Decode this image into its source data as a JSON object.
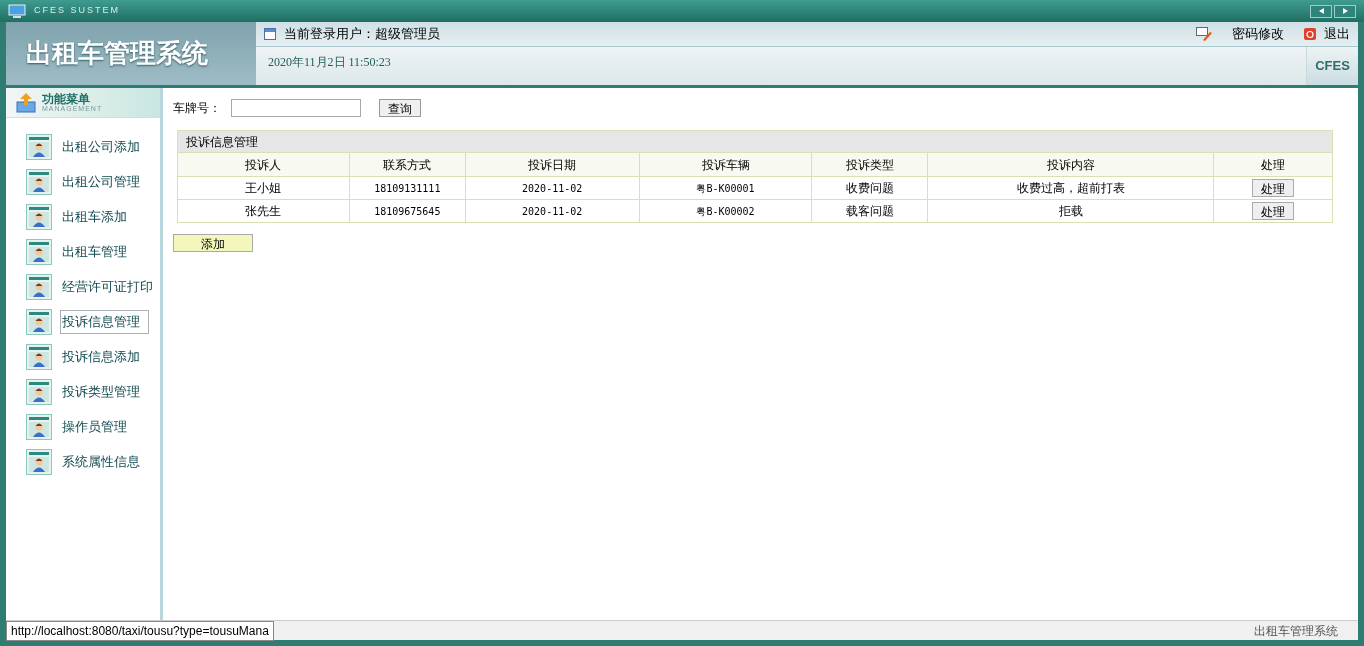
{
  "window": {
    "title": "CFES SUSTEM"
  },
  "header": {
    "app_title": "出租车管理系统",
    "user_label": "当前登录用户：超级管理员",
    "datetime": "2020年11月2日 11:50:23",
    "links": [
      "密码修改",
      "退出"
    ],
    "badge": "CFES"
  },
  "sidebar": {
    "title": "功能菜单",
    "subtitle": "MANAGEMENT",
    "items": [
      {
        "label": "出租公司添加",
        "selected": false
      },
      {
        "label": "出租公司管理",
        "selected": false
      },
      {
        "label": "出租车添加",
        "selected": false
      },
      {
        "label": "出租车管理",
        "selected": false
      },
      {
        "label": "经营许可证打印",
        "selected": false
      },
      {
        "label": "投诉信息管理",
        "selected": true
      },
      {
        "label": "投诉信息添加",
        "selected": false
      },
      {
        "label": "投诉类型管理",
        "selected": false
      },
      {
        "label": "操作员管理",
        "selected": false
      },
      {
        "label": "系统属性信息",
        "selected": false
      }
    ]
  },
  "search": {
    "label": "车牌号：",
    "button": "查询"
  },
  "table": {
    "title": "投诉信息管理",
    "columns": [
      "投诉人",
      "联系方式",
      "投诉日期",
      "投诉车辆",
      "投诉类型",
      "投诉内容",
      "处理"
    ],
    "rows": [
      {
        "cells": [
          "王小姐",
          "18109131111",
          "2020-11-02",
          "粤B-K00001",
          "收费问题",
          "收费过高，超前打表"
        ],
        "action": "处理"
      },
      {
        "cells": [
          "张先生",
          "18109675645",
          "2020-11-02",
          "粤B-K00002",
          "载客问题",
          "拒载"
        ],
        "action": "处理"
      }
    ]
  },
  "add_button": "添加",
  "status_bar": {
    "url": "http://localhost:8080/taxi/tousu?type=tousuMana",
    "right": "出租车管理系统"
  }
}
